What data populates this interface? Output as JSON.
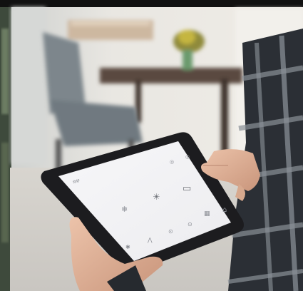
{
  "scene": {
    "description_free": true,
    "colors": {
      "wall": "#e7e4dd",
      "floor": "#d9d6d1",
      "tablet_bezel": "#1c1c1f",
      "tablet_screen": "#f4f4f6",
      "skin": "#e0b49c",
      "shirt_dark": "#2b2f35"
    }
  },
  "app": {
    "greeting": "你好",
    "icons": [
      {
        "name": "scene-icon",
        "glyph": "◎"
      },
      {
        "name": "mode-icon",
        "glyph": "◎"
      },
      {
        "name": "snowflake-icon",
        "glyph": "❄"
      },
      {
        "name": "light-icon",
        "glyph": "☀"
      },
      {
        "name": "tv-icon",
        "glyph": "▭"
      },
      {
        "name": "lock-icon",
        "glyph": "▦"
      },
      {
        "name": "home-icon",
        "glyph": "⌂"
      },
      {
        "name": "fan-icon",
        "glyph": "✱"
      },
      {
        "name": "curtain-icon",
        "glyph": "⋀"
      },
      {
        "name": "power-icon",
        "glyph": "⊙"
      },
      {
        "name": "settings-icon",
        "glyph": "⊙"
      }
    ]
  }
}
